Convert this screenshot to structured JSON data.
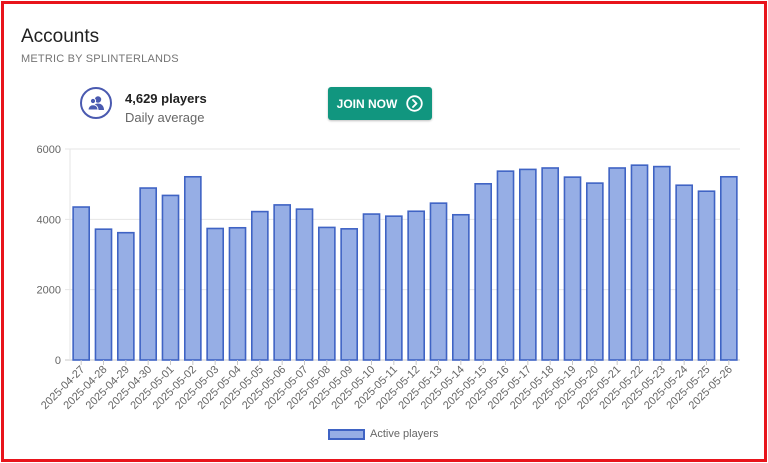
{
  "header": {
    "title": "Accounts",
    "subtitle": "METRIC BY SPLINTERLANDS"
  },
  "stat": {
    "icon": "users-icon",
    "value": "4,629 players",
    "caption": "Daily average"
  },
  "cta": {
    "label": "JOIN NOW",
    "icon": "chevron-right-circle-icon"
  },
  "colors": {
    "bar_fill": "#96aee5",
    "bar_stroke": "#3f63c4",
    "button": "#11967f",
    "border": "#e8141b"
  },
  "chart_data": {
    "type": "bar",
    "categories": [
      "2025-04-27",
      "2025-04-28",
      "2025-04-29",
      "2025-04-30",
      "2025-05-01",
      "2025-05-02",
      "2025-05-03",
      "2025-05-04",
      "2025-05-05",
      "2025-05-06",
      "2025-05-07",
      "2025-05-08",
      "2025-05-09",
      "2025-05-10",
      "2025-05-11",
      "2025-05-12",
      "2025-05-13",
      "2025-05-14",
      "2025-05-15",
      "2025-05-16",
      "2025-05-17",
      "2025-05-18",
      "2025-05-19",
      "2025-05-20",
      "2025-05-21",
      "2025-05-22",
      "2025-05-23",
      "2025-05-24",
      "2025-05-25",
      "2025-05-26"
    ],
    "series": [
      {
        "name": "Active players",
        "values": [
          4350,
          3720,
          3620,
          4890,
          4680,
          5210,
          3740,
          3760,
          4220,
          4410,
          4290,
          3770,
          3730,
          4150,
          4090,
          4230,
          4460,
          4130,
          5010,
          5370,
          5420,
          5460,
          5200,
          5030,
          5460,
          5540,
          5500,
          4970,
          4800,
          5210
        ]
      }
    ],
    "yticks": [
      0,
      2000,
      4000,
      6000
    ],
    "ylim": [
      0,
      6000
    ],
    "grid": true,
    "legend": "bottom"
  }
}
